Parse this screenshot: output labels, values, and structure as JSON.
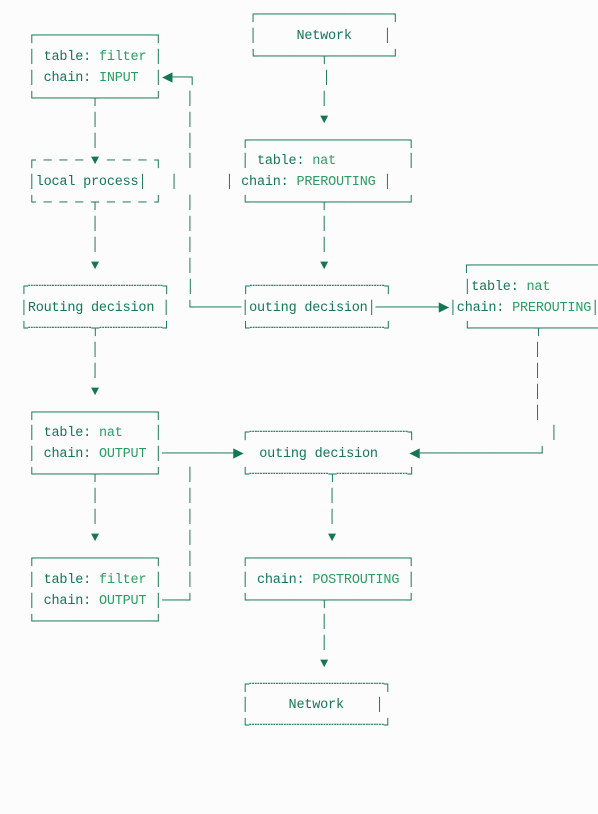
{
  "boxes": {
    "network": "Network",
    "filter_input": {
      "table": "filter",
      "chain": "INPUT"
    },
    "local_process": "local process",
    "nat_prerouting": {
      "table": "nat",
      "chain": "PREROUTING"
    },
    "routing_decision": "Routing decision",
    "outing_decision": "outing decision",
    "nat_prerouting2": {
      "table": "nat",
      "chain": "PREROUTING"
    },
    "nat_output": {
      "table": "nat",
      "chain": "OUTPUT"
    },
    "filter_output": {
      "table": "filter",
      "chain": "OUTPUT"
    },
    "postrouting": {
      "chain": "POSTROUTING"
    },
    "network_bottom": "Network"
  },
  "labels": {
    "table": "table:",
    "chain": "chain:"
  },
  "colors": {
    "primary": "#137752",
    "accent": "#2a9d63"
  }
}
